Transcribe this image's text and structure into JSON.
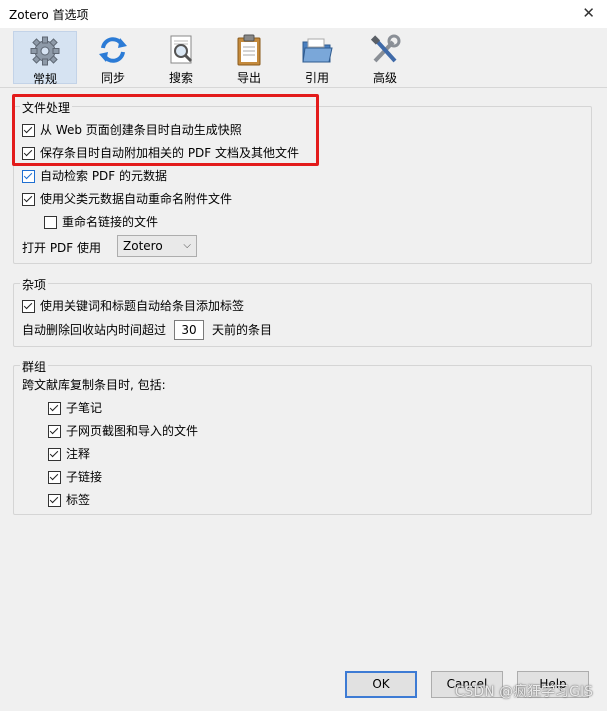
{
  "window": {
    "title": "Zotero 首选项",
    "close_glyph": "✕"
  },
  "toolbar": {
    "tabs": [
      {
        "label": "常规",
        "icon": "gear-icon"
      },
      {
        "label": "同步",
        "icon": "sync-icon"
      },
      {
        "label": "搜索",
        "icon": "search-icon"
      },
      {
        "label": "导出",
        "icon": "clipboard-icon"
      },
      {
        "label": "引用",
        "icon": "folder-icon"
      },
      {
        "label": "高级",
        "icon": "tools-icon"
      }
    ]
  },
  "file_handling": {
    "legend": "文件处理",
    "auto_snapshot": "从 Web 页面创建条目时自动生成快照",
    "auto_attach_pdf": "保存条目时自动附加相关的 PDF 文档及其他文件",
    "auto_retrieve_metadata": "自动检索 PDF 的元数据",
    "auto_rename": "使用父类元数据自动重命名附件文件",
    "rename_linked": "重命名链接的文件",
    "open_pdf_label": "打开 PDF 使用",
    "open_pdf_value": "Zotero",
    "select_arrow": "⌵"
  },
  "misc": {
    "legend": "杂项",
    "auto_tags": "使用关键词和标题自动给条目添加标签",
    "trash_prefix": "自动删除回收站内时间超过",
    "trash_days": "30",
    "trash_suffix": "天前的条目"
  },
  "groups": {
    "legend": "群组",
    "copy_label": "跨文献库复制条目时, 包括:",
    "items": [
      "子笔记",
      "子网页截图和导入的文件",
      "注释",
      "子链接",
      "标签"
    ]
  },
  "buttons": {
    "ok": "OK",
    "cancel": "Cancel",
    "help": "Help"
  },
  "watermark": "CSDN @疯狂学习GIS",
  "colors": {
    "highlight": "#e31b1b",
    "active_tab": "#d6e3f2",
    "default_button_border": "#3d7bd4"
  }
}
